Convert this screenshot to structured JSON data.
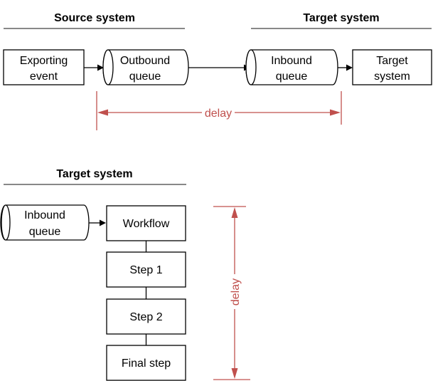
{
  "top_flow": {
    "source_header": "Source system",
    "target_header": "Target system",
    "nodes": {
      "exporting_event": {
        "line1": "Exporting",
        "line2": "event",
        "shape": "rectangle"
      },
      "outbound_queue": {
        "line1": "Outbound",
        "line2": "queue",
        "shape": "cylinder"
      },
      "inbound_queue": {
        "line1": "Inbound",
        "line2": "queue",
        "shape": "cylinder"
      },
      "target_system": {
        "line1": "Target",
        "line2": "system",
        "shape": "rectangle"
      }
    },
    "delay_label": "delay"
  },
  "bottom_flow": {
    "target_header": "Target system",
    "nodes": {
      "inbound_queue": {
        "line1": "Inbound",
        "line2": "queue",
        "shape": "cylinder"
      },
      "workflow": {
        "label": "Workflow",
        "shape": "rectangle"
      },
      "step1": {
        "label": "Step 1",
        "shape": "rectangle"
      },
      "step2": {
        "label": "Step 2",
        "shape": "rectangle"
      },
      "final_step": {
        "label": "Final step",
        "shape": "rectangle"
      }
    },
    "delay_label": "delay"
  },
  "colors": {
    "stroke": "#000000",
    "dimension": "#c0504d",
    "header_rule": "#404040"
  }
}
